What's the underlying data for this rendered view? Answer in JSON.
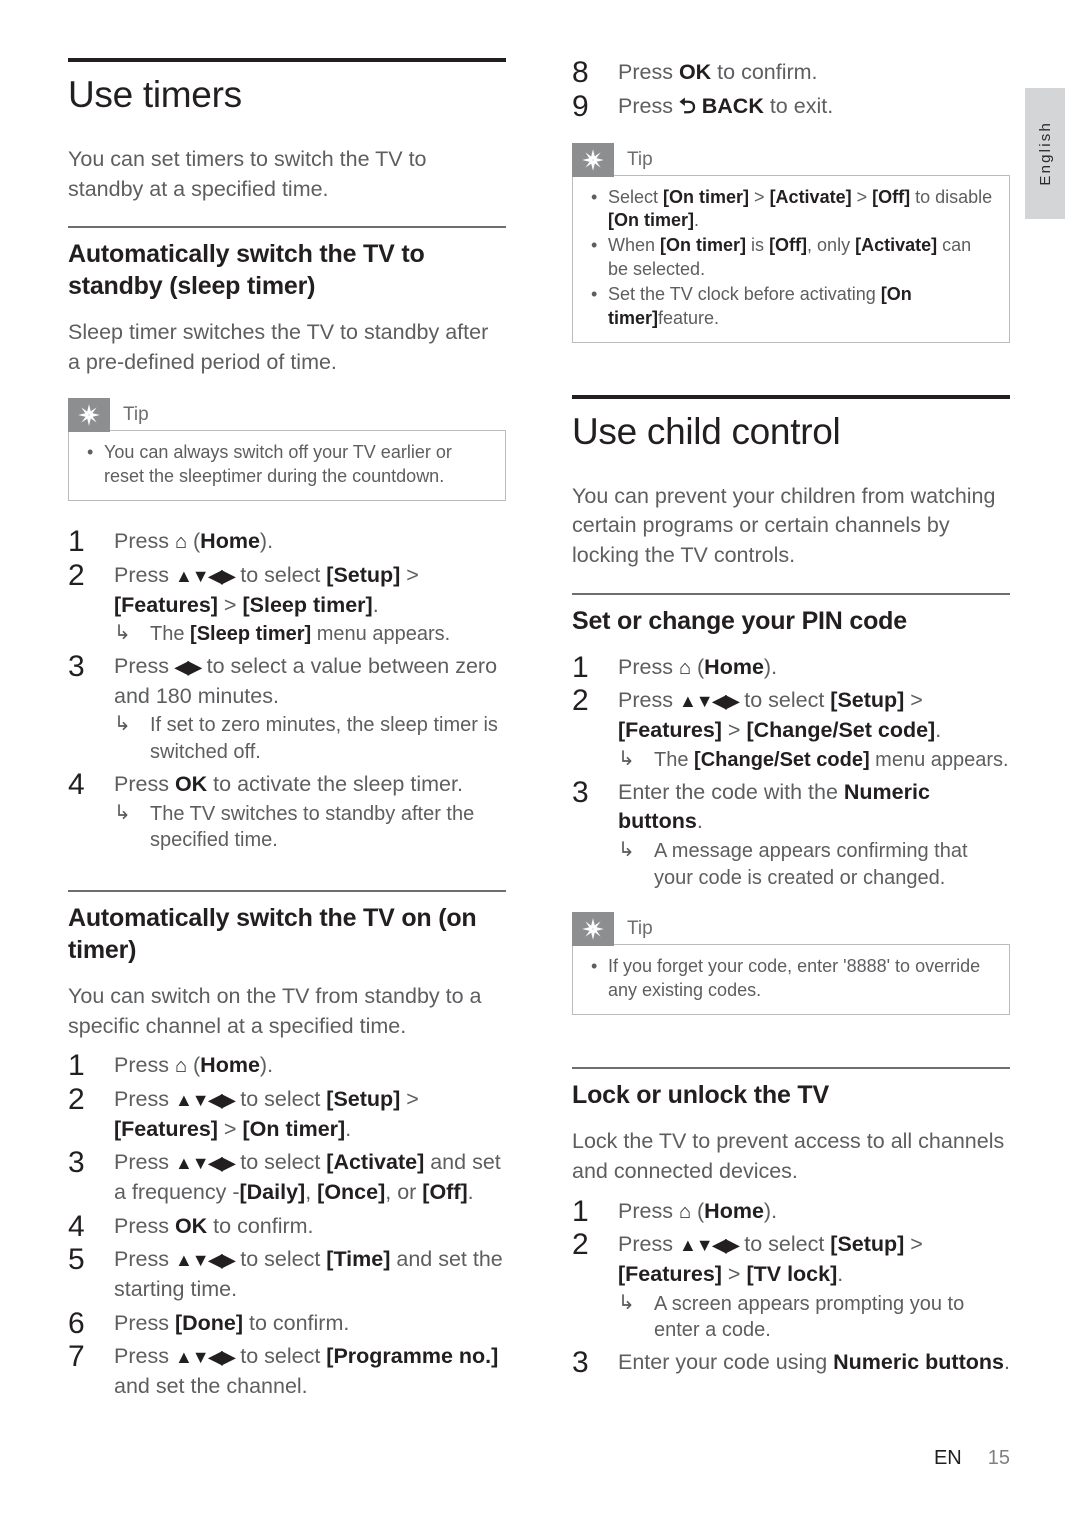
{
  "page": {
    "language_tab": "English",
    "footer_region": "EN",
    "footer_page": "15",
    "colors": {
      "rule_dark": "#231f20",
      "rule_light": "#6d6e71",
      "tip_icon_bg": "#8d8e90",
      "tab_bg": "#d4d5d7",
      "body_text": "#5d5e60"
    }
  },
  "left_column": {
    "section": {
      "title": "Use timers",
      "intro": "You can set timers to switch the TV to standby at a specified time."
    },
    "sleep_timer": {
      "heading": "Automatically switch the TV to standby (sleep timer)",
      "intro": "Sleep timer switches the TV to standby after a pre-defined period of time.",
      "tip": {
        "label": "Tip",
        "icon": "tip-asterisk-icon",
        "items": [
          "You can always switch off your TV earlier or reset the sleeptimer during the countdown."
        ]
      },
      "steps": [
        {
          "num": "1",
          "text_before": "Press ",
          "icon": "home-icon",
          "text_after": " (Home)."
        },
        {
          "num": "2",
          "text": "Press ▲▼◀▶ to select [Setup] > [Features] > [Sleep timer].",
          "result": "The [Sleep timer] menu appears."
        },
        {
          "num": "3",
          "text": "Press ◀▶ to select a value between zero and 180 minutes.",
          "result": "If set to zero minutes, the sleep timer is switched off."
        },
        {
          "num": "4",
          "text": "Press OK to activate the sleep timer.",
          "result": "The TV switches to standby after the specified time."
        }
      ]
    },
    "on_timer": {
      "heading": "Automatically switch the TV on (on timer)",
      "intro": "You can switch on the TV from standby to a specific channel at a specified time.",
      "steps": [
        {
          "num": "1",
          "text_before": "Press ",
          "icon": "home-icon",
          "text_after": " (Home)."
        },
        {
          "num": "2",
          "text": "Press ▲▼◀▶ to select [Setup] > [Features] > [On timer]."
        },
        {
          "num": "3",
          "text": "Press ▲▼◀▶ to select [Activate] and set a frequency -[Daily], [Once], or [Off]."
        },
        {
          "num": "4",
          "text": "Press OK to confirm."
        },
        {
          "num": "5",
          "text": "Press ▲▼◀▶ to select [Time] and set the starting time."
        },
        {
          "num": "6",
          "text": "Press [Done] to confirm."
        },
        {
          "num": "7",
          "text": "Press ▲▼◀▶ to select [Programme no.] and set the channel."
        }
      ]
    }
  },
  "right_column": {
    "on_timer_continued": {
      "steps": [
        {
          "num": "8",
          "text": "Press OK to confirm."
        },
        {
          "num": "9",
          "text_before": "Press ",
          "icon": "back-icon",
          "text_after": " BACK to exit."
        }
      ],
      "tip": {
        "label": "Tip",
        "icon": "tip-asterisk-icon",
        "items": [
          "Select [On timer] > [Activate] > [Off] to disable [On timer].",
          "When [On timer] is [Off], only [Activate] can be selected.",
          "Set the TV clock before activating [On timer]feature."
        ]
      }
    },
    "section": {
      "title": "Use child control",
      "intro": "You can prevent your children from watching certain programs or certain channels by locking the TV controls."
    },
    "pin_code": {
      "heading": "Set or change your PIN code",
      "steps": [
        {
          "num": "1",
          "text_before": "Press ",
          "icon": "home-icon",
          "text_after": " (Home)."
        },
        {
          "num": "2",
          "text": "Press ▲▼◀▶ to select [Setup] > [Features] > [Change/Set code].",
          "result": "The [Change/Set code] menu appears."
        },
        {
          "num": "3",
          "text": "Enter the code with the Numeric buttons.",
          "result": "A message appears confirming that your code is created or changed."
        }
      ],
      "tip": {
        "label": "Tip",
        "icon": "tip-asterisk-icon",
        "items": [
          "If you forget your code, enter '8888' to override any existing codes."
        ]
      }
    },
    "tv_lock": {
      "heading": "Lock or unlock the TV",
      "intro": "Lock the TV to prevent access to all channels and connected devices.",
      "steps": [
        {
          "num": "1",
          "text_before": "Press ",
          "icon": "home-icon",
          "text_after": " (Home)."
        },
        {
          "num": "2",
          "text": "Press ▲▼◀▶ to select [Setup] > [Features] > [TV lock].",
          "result": "A screen appears prompting you to enter a code."
        },
        {
          "num": "3",
          "text": "Enter your code using Numeric buttons."
        }
      ]
    }
  }
}
